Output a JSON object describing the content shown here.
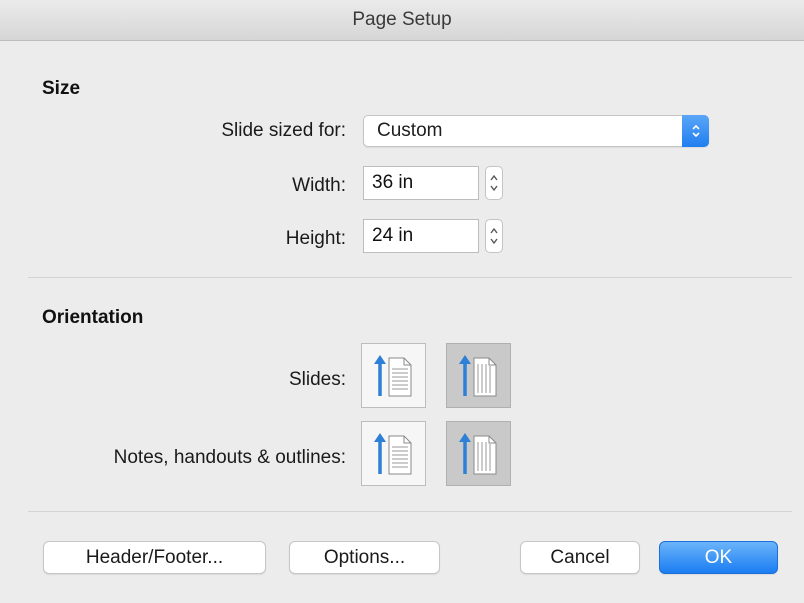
{
  "window": {
    "title": "Page Setup"
  },
  "size": {
    "heading": "Size",
    "slide_sized_for": {
      "label": "Slide sized for:",
      "value": "Custom"
    },
    "width": {
      "label": "Width:",
      "value": "36 in"
    },
    "height": {
      "label": "Height:",
      "value": "24 in"
    }
  },
  "orientation": {
    "heading": "Orientation",
    "slides": {
      "label": "Slides:",
      "selected": "landscape"
    },
    "notes": {
      "label": "Notes, handouts & outlines:",
      "selected": "landscape"
    }
  },
  "buttons": {
    "header_footer": "Header/Footer...",
    "options": "Options...",
    "cancel": "Cancel",
    "ok": "OK"
  },
  "colors": {
    "accent": "#1f7ef0",
    "icon_blue": "#2e7fd6"
  }
}
